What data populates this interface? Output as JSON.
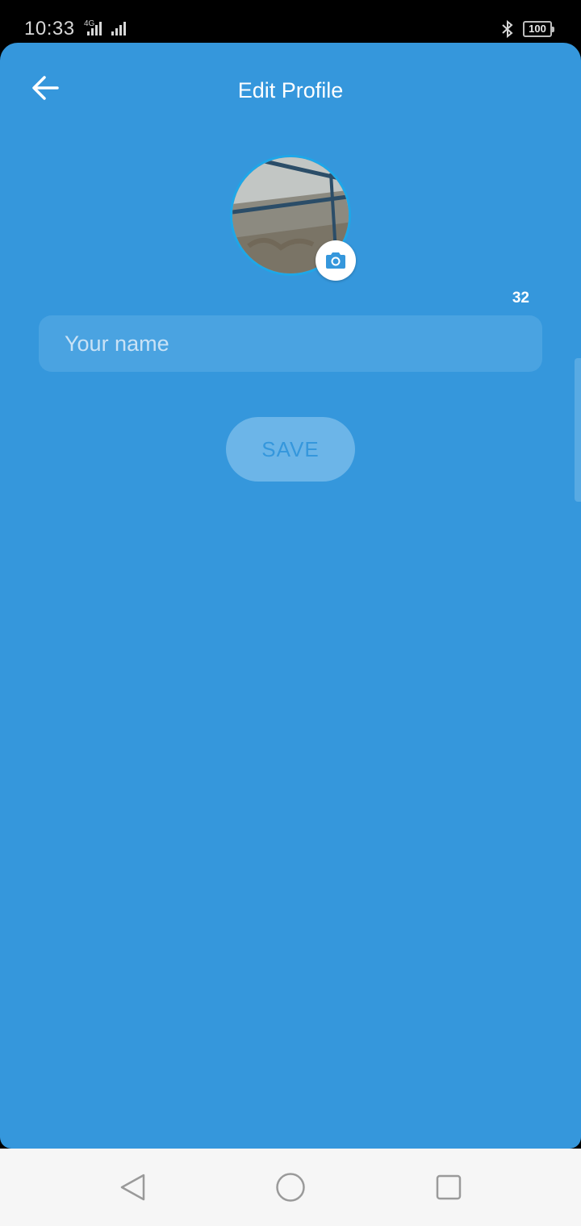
{
  "status_bar": {
    "time": "10:33",
    "network_type": "4G",
    "battery_level": "100",
    "icons": [
      "signal-icon",
      "bluetooth-icon",
      "battery-icon"
    ]
  },
  "header": {
    "title": "Edit Profile",
    "back_icon": "arrow-left-icon"
  },
  "profile": {
    "avatar_icon": "avatar-photo",
    "camera_icon": "camera-icon"
  },
  "form": {
    "char_count": "32",
    "name_placeholder": "Your name",
    "name_value": "",
    "save_label": "SAVE"
  },
  "nav": {
    "back_icon": "triangle-back-icon",
    "home_icon": "circle-home-icon",
    "recents_icon": "square-recents-icon"
  },
  "colors": {
    "primary": "#3597dc",
    "input_bg": "#4aa3e1",
    "button_bg": "#6cb5e8",
    "avatar_ring": "#1ea7e8"
  }
}
